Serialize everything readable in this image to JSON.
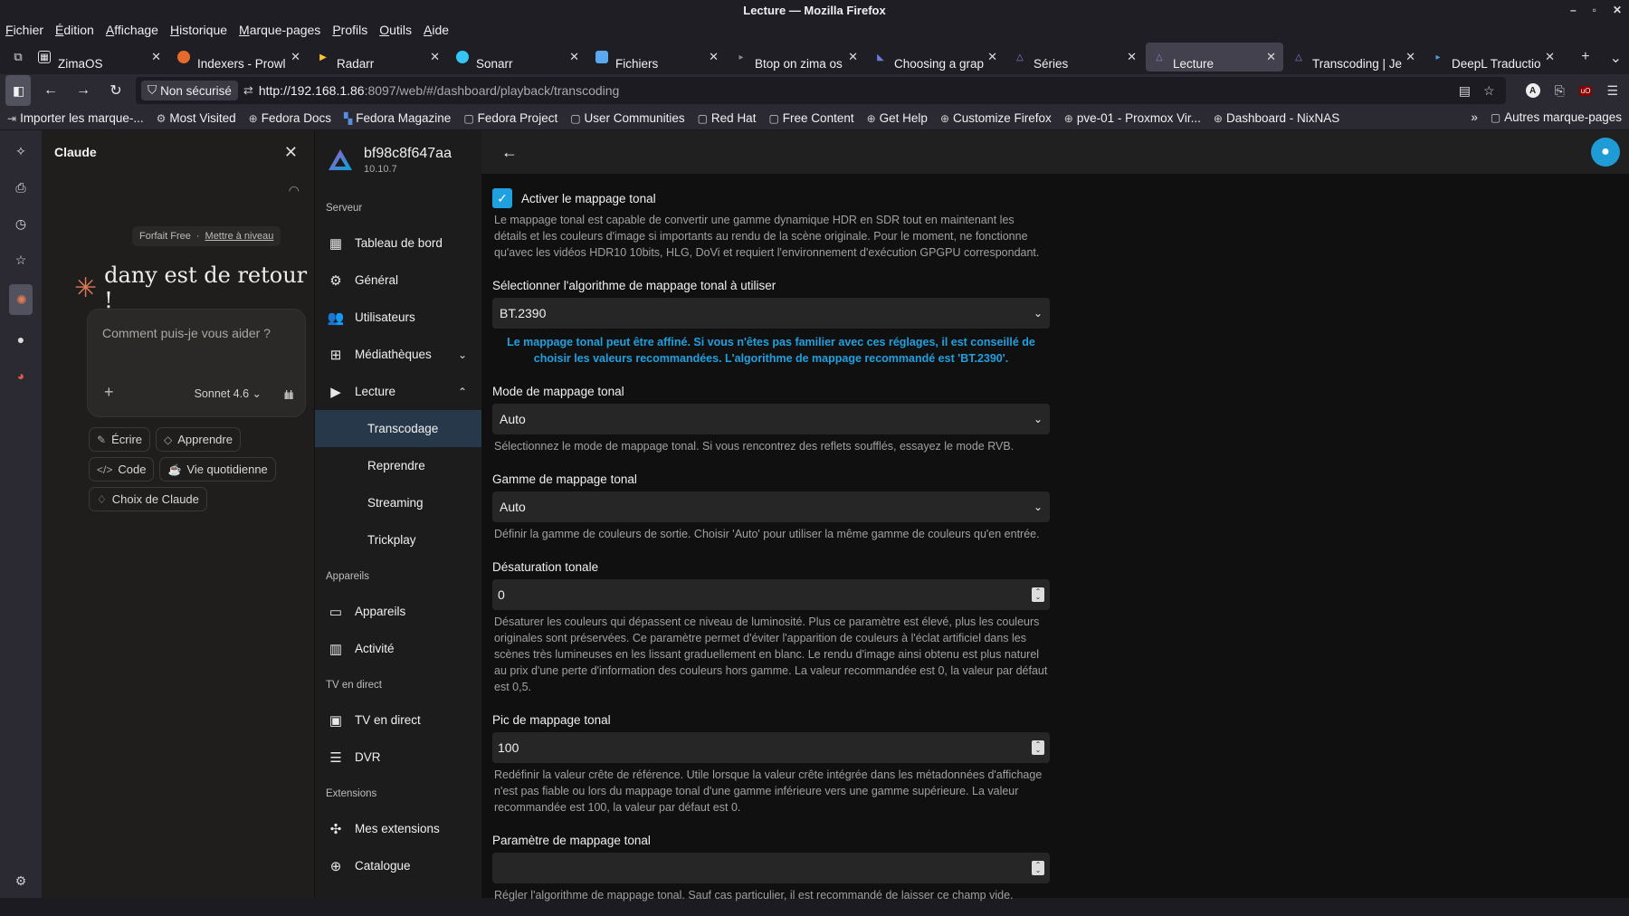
{
  "window": {
    "title": "Lecture — Mozilla Firefox",
    "controls": [
      "–",
      "▫",
      "✕"
    ]
  },
  "menu": [
    "Fichier",
    "Édition",
    "Affichage",
    "Historique",
    "Marque-pages",
    "Profils",
    "Outils",
    "Aide"
  ],
  "tabs": [
    {
      "label": "ZimaOS",
      "color": "#ffffff",
      "active": false
    },
    {
      "label": "Indexers - Prowl",
      "color": "#e46b2b",
      "active": false
    },
    {
      "label": "Radarr",
      "color": "#ffc230",
      "active": false
    },
    {
      "label": "Sonarr",
      "color": "#35c5f4",
      "active": false
    },
    {
      "label": "Fichiers",
      "color": "#5aa8f0",
      "active": false
    },
    {
      "label": "Btop on zima os",
      "color": "#555555",
      "active": false
    },
    {
      "label": "Choosing a grapl",
      "color": "#3f4bb0",
      "active": false
    },
    {
      "label": "Séries",
      "color": "#9b7bd8",
      "active": false
    },
    {
      "label": "Lecture",
      "color": "#9b7bd8",
      "active": true
    },
    {
      "label": "Transcoding | Je",
      "color": "#9b7bd8",
      "active": false
    },
    {
      "label": "DeepL Traductio",
      "color": "#4aa3df",
      "active": false
    }
  ],
  "navbar": {
    "security": "Non sécurisé",
    "url_host": "http://192.168.1.86",
    "url_rest": ":8097/web/#/dashboard/playback/transcoding"
  },
  "bookmarks": [
    {
      "label": "Importer les marque-...",
      "icon": "⇥"
    },
    {
      "label": "Most Visited",
      "icon": "⚙"
    },
    {
      "label": "Fedora Docs",
      "icon": "⊕"
    },
    {
      "label": "Fedora Magazine",
      "icon": "▚"
    },
    {
      "label": "Fedora Project",
      "icon": "▢"
    },
    {
      "label": "User Communities",
      "icon": "▢"
    },
    {
      "label": "Red Hat",
      "icon": "▢"
    },
    {
      "label": "Free Content",
      "icon": "▢"
    },
    {
      "label": "Get Help",
      "icon": "⊕"
    },
    {
      "label": "Customize Firefox",
      "icon": "⊕"
    },
    {
      "label": "pve-01 - Proxmox Vir...",
      "icon": "⊕"
    },
    {
      "label": "Dashboard - NixNAS",
      "icon": "⊕"
    }
  ],
  "bookmarks_other": "Autres marque-pages",
  "claude": {
    "title": "Claude",
    "plan": "Forfait Free",
    "upgrade": "Mettre à niveau",
    "welcome": "dany est de retour !",
    "input_placeholder": "Comment puis-je vous aider ?",
    "model": "Sonnet 4.6",
    "chips": [
      {
        "label": "Écrire",
        "icon": "✎"
      },
      {
        "label": "Apprendre",
        "icon": "◇"
      },
      {
        "label": "Code",
        "icon": "</>"
      },
      {
        "label": "Vie quotidienne",
        "icon": "☕"
      },
      {
        "label": "Choix de Claude",
        "icon": "♢"
      }
    ]
  },
  "jellyfin": {
    "server_name": "bf98c8f647aa",
    "version": "10.10.7",
    "sections": {
      "server": "Serveur",
      "devices": "Appareils",
      "livetv": "TV en direct",
      "extensions": "Extensions"
    },
    "server_items": [
      {
        "label": "Tableau de bord",
        "icon": "▦"
      },
      {
        "label": "Général",
        "icon": "⚙"
      },
      {
        "label": "Utilisateurs",
        "icon": "👥"
      },
      {
        "label": "Médiathèques",
        "icon": "⊞"
      },
      {
        "label": "Lecture",
        "icon": "▶"
      }
    ],
    "playback_subitems": [
      "Transcodage",
      "Reprendre",
      "Streaming",
      "Trickplay"
    ],
    "device_items": [
      {
        "label": "Appareils",
        "icon": "▭"
      },
      {
        "label": "Activité",
        "icon": "▥"
      }
    ],
    "livetv_items": [
      {
        "label": "TV en direct",
        "icon": "▣"
      },
      {
        "label": "DVR",
        "icon": "☰"
      }
    ],
    "extension_items": [
      {
        "label": "Mes extensions",
        "icon": "✣"
      },
      {
        "label": "Catalogue",
        "icon": "⊕"
      }
    ]
  },
  "form": {
    "tonemap_enable_label": "Activer le mappage tonal",
    "tonemap_enable_desc": "Le mappage tonal est capable de convertir une gamme dynamique HDR en SDR tout en maintenant les détails et les couleurs d'image si importants au rendu de la scène originale. Pour le moment, ne fonctionne qu'avec les vidéos HDR10 10bits, HLG, DoVi et requiert l'environnement d'exécution GPGPU correspondant.",
    "algo_label": "Sélectionner l'algorithme de mappage tonal à utiliser",
    "algo_value": "BT.2390",
    "algo_hint": "Le mappage tonal peut être affiné. Si vous n'êtes pas familier avec ces réglages, il est conseillé de choisir les valeurs recommandées. L'algorithme de mappage recommandé est 'BT.2390'.",
    "mode_label": "Mode de mappage tonal",
    "mode_value": "Auto",
    "mode_desc": "Sélectionnez le mode de mappage tonal. Si vous rencontrez des reflets soufflés, essayez le mode RVB.",
    "range_label": "Gamme de mappage tonal",
    "range_value": "Auto",
    "range_desc": "Définir la gamme de couleurs de sortie. Choisir 'Auto' pour utiliser la même gamme de couleurs qu'en entrée.",
    "desat_label": "Désaturation tonale",
    "desat_value": "0",
    "desat_desc": "Désaturer les couleurs qui dépassent ce niveau de luminosité. Plus ce paramètre est élevé, plus les couleurs originales sont préservées. Ce paramètre permet d'éviter l'apparition de couleurs à l'éclat artificiel dans les scènes très lumineuses en les lissant graduellement en blanc. Le rendu d'image ainsi obtenu est plus naturel au prix d'une perte d'information des couleurs hors gamme. La valeur recommandée est 0, la valeur par défaut est 0,5.",
    "peak_label": "Pic de mappage tonal",
    "peak_value": "100",
    "peak_desc": "Redéfinir la valeur crête de référence. Utile lorsque la valeur crête intégrée dans les métadonnées d'affichage n'est pas fiable ou lors du mappage tonal d'une gamme inférieure vers une gamme supérieure. La valeur recommandée est 100, la valeur par défaut est 0.",
    "param_label": "Paramètre de mappage tonal",
    "param_value": "",
    "param_desc": "Régler l'algorithme de mappage tonal. Sauf cas particulier, il est recommandé de laisser ce champ vide."
  }
}
